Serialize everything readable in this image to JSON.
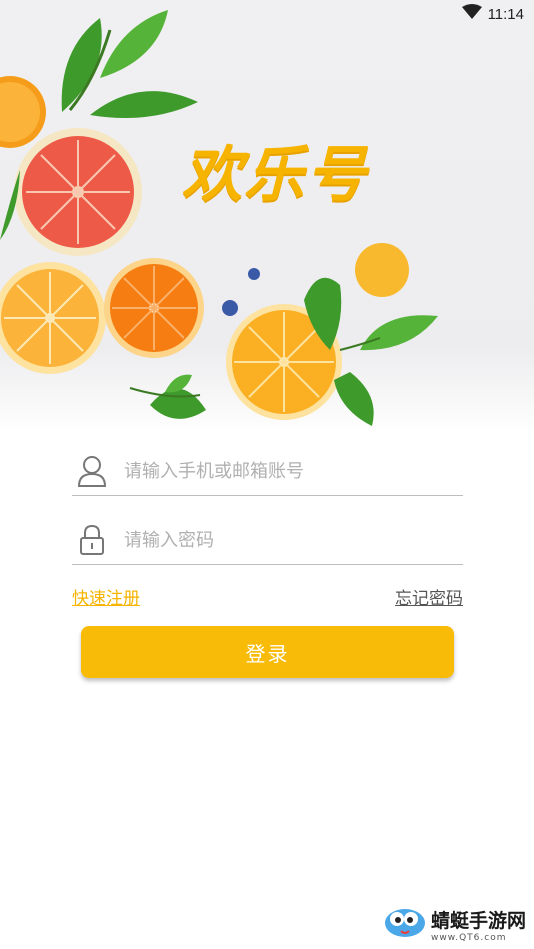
{
  "status_bar": {
    "time": "11:14",
    "wifi_icon": "wifi-icon"
  },
  "hero": {
    "title": "欢乐号"
  },
  "login_form": {
    "account_placeholder": "请输入手机或邮箱账号",
    "password_placeholder": "请输入密码",
    "register_link": "快速注册",
    "forgot_link": "忘记密码",
    "login_button": "登录"
  },
  "watermark": {
    "name": "蜻蜓手游网",
    "url": "www.QT6.com"
  },
  "colors": {
    "accent": "#f8bb08",
    "link": "#f6b400"
  }
}
